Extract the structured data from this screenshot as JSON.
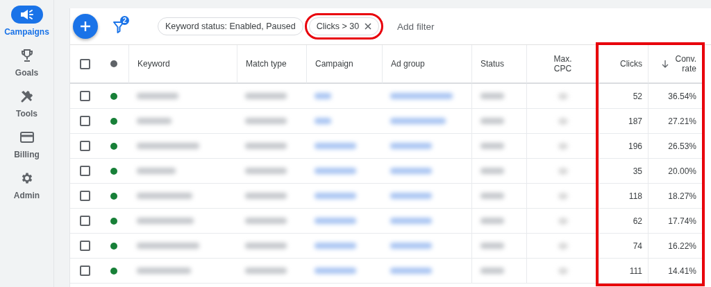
{
  "sidebar": {
    "items": [
      {
        "label": "Campaigns",
        "selected": true
      },
      {
        "label": "Goals",
        "selected": false
      },
      {
        "label": "Tools",
        "selected": false
      },
      {
        "label": "Billing",
        "selected": false
      },
      {
        "label": "Admin",
        "selected": false
      }
    ]
  },
  "toolbar": {
    "filter_count": "2",
    "filters": [
      {
        "label": "Keyword status: Enabled, Paused",
        "removable": false,
        "highlighted": false
      },
      {
        "label": "Clicks > 30",
        "removable": true,
        "highlighted": true
      }
    ],
    "add_filter": "Add filter"
  },
  "table": {
    "select_all_checked": false,
    "columns": [
      {
        "label": "Keyword",
        "kind": "blur",
        "sorted": false,
        "highlighted": false
      },
      {
        "label": "Match type",
        "kind": "blur",
        "sorted": false,
        "highlighted": false
      },
      {
        "label": "Campaign",
        "kind": "blur-link",
        "sorted": false,
        "highlighted": false
      },
      {
        "label": "Ad group",
        "kind": "blur-link",
        "sorted": false,
        "highlighted": false
      },
      {
        "label": "Status",
        "kind": "blur",
        "sorted": false,
        "highlighted": false
      },
      {
        "label": "Max.\nCPC",
        "kind": "blur-dot",
        "sorted": false,
        "highlighted": false
      },
      {
        "label": "Clicks",
        "kind": "number",
        "sorted": false,
        "highlighted": true
      },
      {
        "label": "Conv.\nrate",
        "kind": "number",
        "sorted": true,
        "highlighted": true
      }
    ],
    "rows": [
      {
        "checked": false,
        "color": "#188038",
        "values": [
          "52",
          "36.54%"
        ]
      },
      {
        "checked": false,
        "color": "#188038",
        "values": [
          "187",
          "27.21%"
        ]
      },
      {
        "checked": false,
        "color": "#188038",
        "values": [
          "196",
          "26.53%"
        ]
      },
      {
        "checked": false,
        "color": "#188038",
        "values": [
          "35",
          "20.00%"
        ]
      },
      {
        "checked": false,
        "color": "#188038",
        "values": [
          "118",
          "18.27%"
        ]
      },
      {
        "checked": false,
        "color": "#188038",
        "values": [
          "62",
          "17.74%"
        ]
      },
      {
        "checked": false,
        "color": "#188038",
        "values": [
          "74",
          "16.22%"
        ]
      },
      {
        "checked": false,
        "color": "#188038",
        "values": [
          "111",
          "14.41%"
        ]
      }
    ]
  }
}
